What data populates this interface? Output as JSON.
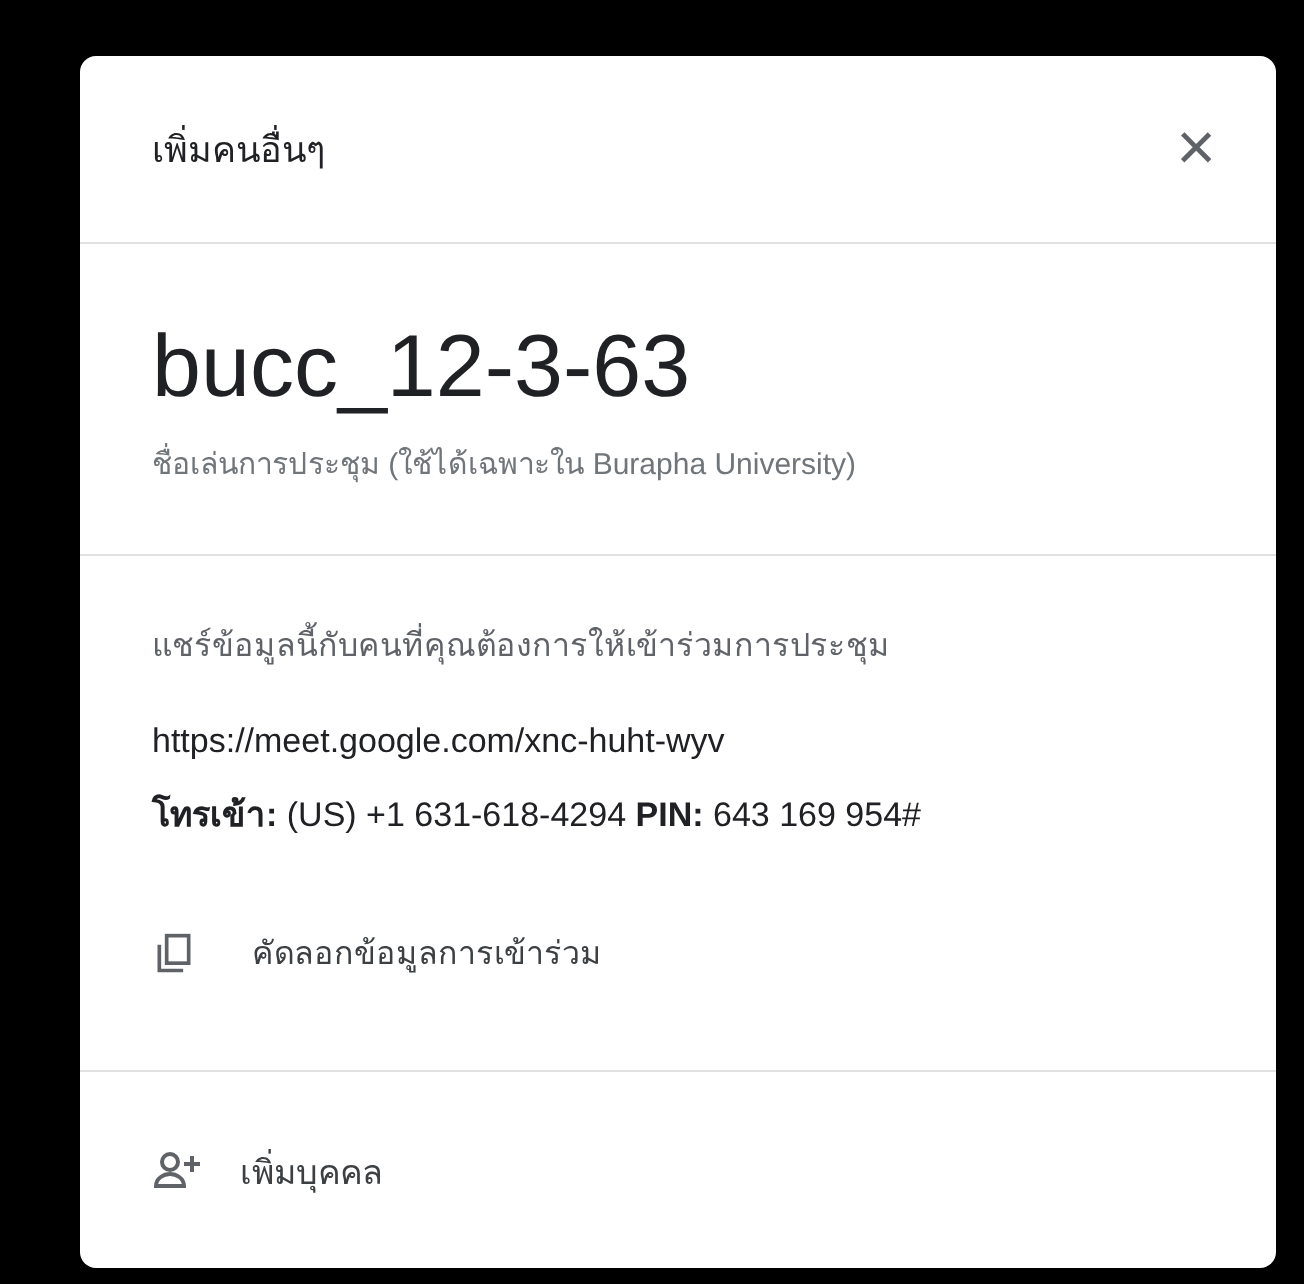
{
  "dialog": {
    "title": "เพิ่มคนอื่นๆ",
    "close_label": "×"
  },
  "meeting": {
    "name": "bucc_12-3-63",
    "note": "ชื่อเล่นการประชุม (ใช้ได้เฉพาะใน Burapha University)"
  },
  "share": {
    "instruction": "แชร์ข้อมูลนี้กับคนที่คุณต้องการให้เข้าร่วมการประชุม",
    "link": "https://meet.google.com/xnc-huht-wyv",
    "dial_in": "**โทรเข้า:** (US) +1 631-618-4294  **PIN:** 643 169 954#",
    "copy_label": "คัดลอกข้อมูลการเข้าร่วม"
  },
  "add_person": {
    "label": "เพิ่มบุคคล"
  }
}
